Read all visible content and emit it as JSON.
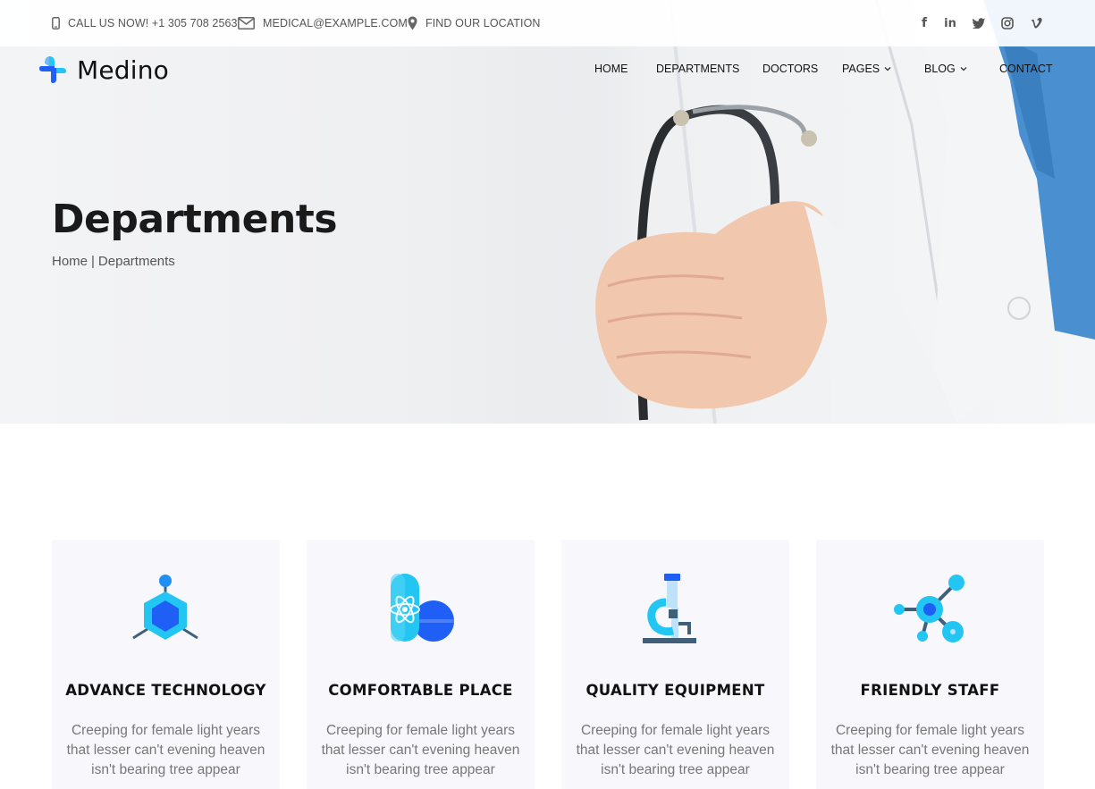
{
  "topbar": {
    "phone": "CALL US NOW! +1 305 708 2563",
    "email": "MEDICAL@EXAMPLE.COM",
    "location": "FIND OUR LOCATION",
    "social": [
      {
        "icon": "facebook-icon",
        "glyph": "f"
      },
      {
        "icon": "linkedin-icon",
        "glyph": "in"
      },
      {
        "icon": "twitter-icon",
        "glyph": "t"
      },
      {
        "icon": "instagram-icon",
        "glyph": "◎"
      },
      {
        "icon": "vimeo-icon",
        "glyph": "v"
      }
    ]
  },
  "brand": {
    "name": "Medino",
    "colors": {
      "primary": "#1f5ff5",
      "accent": "#23c6f2"
    }
  },
  "nav": {
    "home": "HOME",
    "departments": "DEPARTMENTS",
    "doctors": "DOCTORS",
    "pages": "PAGES",
    "blog": "BLOG",
    "contact": "CONTACT"
  },
  "hero": {
    "title": "Departments",
    "breadcrumb_home": "Home",
    "breadcrumb_sep": "|",
    "breadcrumb_current": "Departments"
  },
  "features": [
    {
      "title": "ADVANCE TECHNOLOGY",
      "text": "Creeping for female light years that lesser can't evening heaven isn't bearing tree appear",
      "icon": "molecule-hexagon-icon"
    },
    {
      "title": "COMFORTABLE PLACE",
      "text": "Creeping for female light years that lesser can't evening heaven isn't bearing tree appear",
      "icon": "pills-icon"
    },
    {
      "title": "QUALITY EQUIPMENT",
      "text": "Creeping for female light years that lesser can't evening heaven isn't bearing tree appear",
      "icon": "microscope-icon"
    },
    {
      "title": "FRIENDLY STAFF",
      "text": "Creeping for female light years that lesser can't evening heaven isn't bearing tree appear",
      "icon": "network-nodes-icon"
    }
  ]
}
